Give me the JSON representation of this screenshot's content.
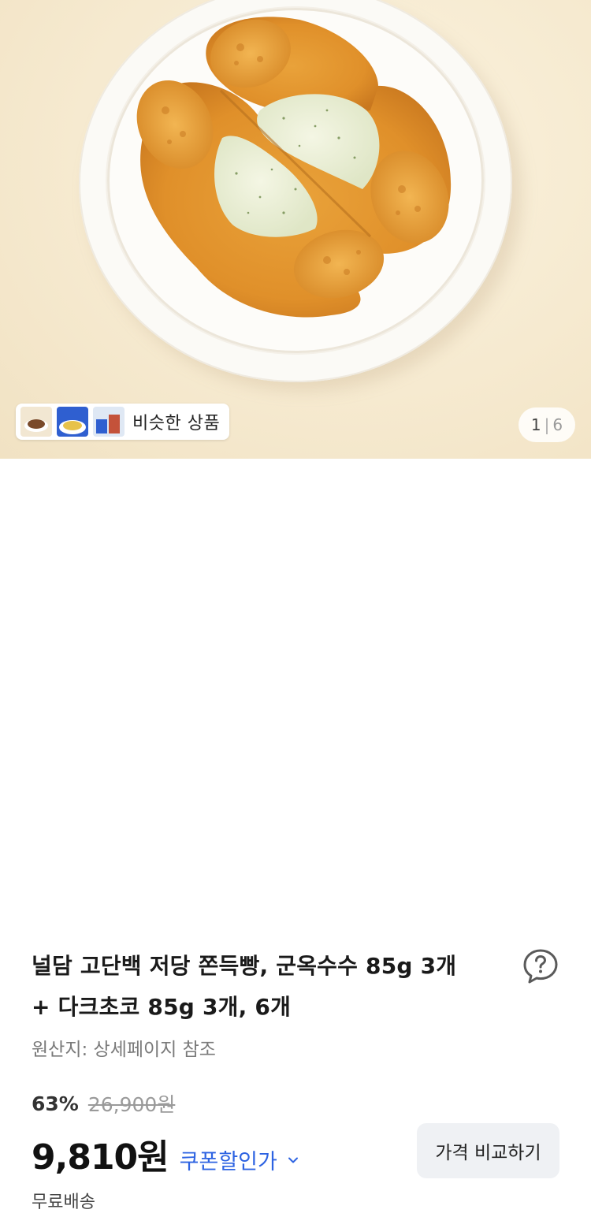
{
  "gallery": {
    "similar_label": "비슷한 상품",
    "counter_current": "1",
    "counter_sep": "|",
    "counter_total": "6",
    "thumbnails": [
      "similar-product-1",
      "similar-product-2",
      "similar-product-3"
    ]
  },
  "product": {
    "title_line1": "널담 고단백 저당 쫀득빵, 군옥수수 85g 3개",
    "title_line2": "+ 다크초코 85g 3개, 6개",
    "origin": "원산지: 상세페이지 참조",
    "discount": "63%",
    "original_price": "26,900원",
    "price": "9,810원",
    "coupon_label": "쿠폰할인가",
    "compare_button": "가격 비교하기",
    "shipping": "무료배송"
  },
  "icons": {
    "help": "question-bubble-icon",
    "coupon_toggle": "chevron-down-icon"
  },
  "colors": {
    "coupon_accent": "#2d63e2",
    "hero_background": "#f6ead0"
  }
}
